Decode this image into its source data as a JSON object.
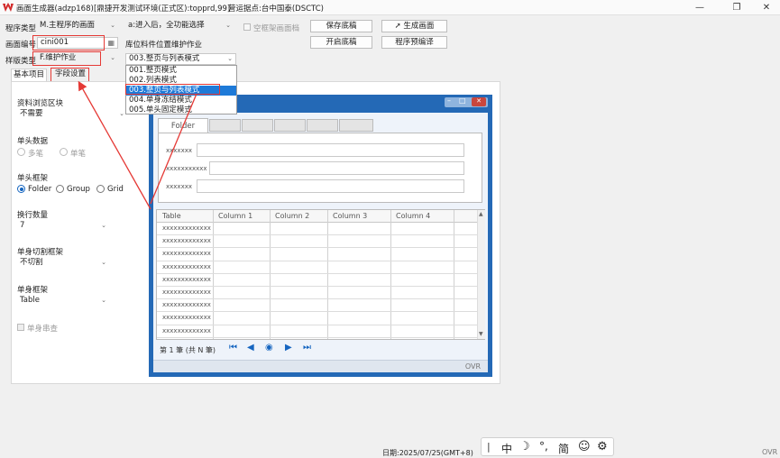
{
  "window": {
    "app_title": "画面生成器(adzp168)",
    "env_title": "[鼎捷开发测试环境(正式区):topprd,99]",
    "site_title": "营运据点:台中国泰(DSCTC)"
  },
  "form": {
    "program_type_label": "程序类型",
    "program_type_value": "M.主程序的画面",
    "entry_value": "a:进入后，全功能选择",
    "empty_frame_label": "空框架画面档",
    "screen_no_label": "画面编号",
    "screen_no_value": "cini001",
    "screen_desc": "库位料件位置维护作业",
    "template_type_label": "样版类型",
    "template_type_value": "F.维护作业",
    "template_mode_value": "003.整页与列表模式"
  },
  "buttons": {
    "save_draft": "保存底稿",
    "generate_screen": "生成画面",
    "open_draft": "开启底稿",
    "program_preview": "程序预编译"
  },
  "dropdown_options": [
    "001.整页模式",
    "002.列表模式",
    "003.整页与列表模式",
    "004.单身冻结模式",
    "005.单头固定模式"
  ],
  "tabs": {
    "basic": "基本项目",
    "fields": "字段设置"
  },
  "settings": {
    "browse_block_label": "资料浏览区块",
    "browse_block_value": "不需要",
    "head_data_label": "单头数据",
    "head_multi": "多笔",
    "head_single": "单笔",
    "head_frame_label": "单头框架",
    "frame_folder": "Folder",
    "frame_group": "Group",
    "frame_grid": "Grid",
    "wrap_count_label": "换行数量",
    "wrap_count_value": "7",
    "body_cut_label": "单身切割框架",
    "body_cut_value": "不切割",
    "body_frame_label": "单身框架",
    "body_frame_value": "Table",
    "body_series_label": "单身串查"
  },
  "preview": {
    "folder_tab": "Folder",
    "field_label_1": "xxxxxxx",
    "field_label_2": "xxxxxxxxxxx",
    "field_label_3": "xxxxxxx",
    "table_headers": [
      "Table",
      "Column 1",
      "Column 2",
      "Column 3",
      "Column 4"
    ],
    "row_cell": "xxxxxxxxxxxxx",
    "pager_text": "第 1 筆 (共 N 筆)",
    "status_ovr": "OVR"
  },
  "statusbar": {
    "date": "日期:2025/07/25(GMT+8)",
    "ovr": "OVR",
    "ime_items": [
      "中",
      "简"
    ]
  },
  "colors": {
    "accent_blue": "#1e7ad8",
    "annotation_red": "#e53935",
    "preview_frame": "#2469b6"
  }
}
